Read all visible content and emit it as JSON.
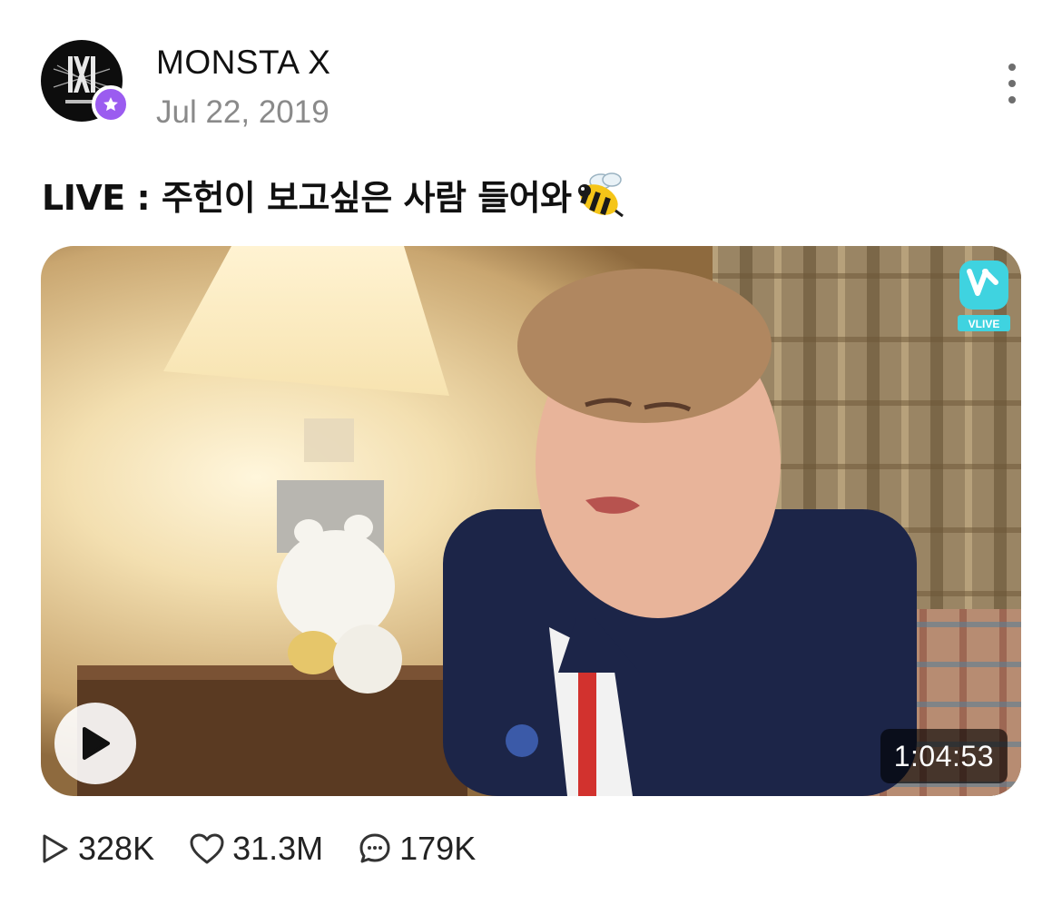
{
  "post": {
    "author": "MONSTA X",
    "date": "Jul 22, 2019",
    "title": "LIVE : 주헌이 보고싶은 사람 들어와",
    "title_emoji": "bee",
    "more_icon": "vertical-ellipsis-icon",
    "avatar_logo_text": "MONSTA X"
  },
  "video": {
    "duration": "1:04:53",
    "watermark": "VLIVE",
    "play_icon": "play-icon"
  },
  "stats": {
    "views": "328K",
    "likes": "31.3M",
    "comments": "179K"
  },
  "colors": {
    "badge": "#9b5cf0",
    "vlive_accent": "#3fd3e0",
    "date_gray": "#8a8a8a"
  }
}
